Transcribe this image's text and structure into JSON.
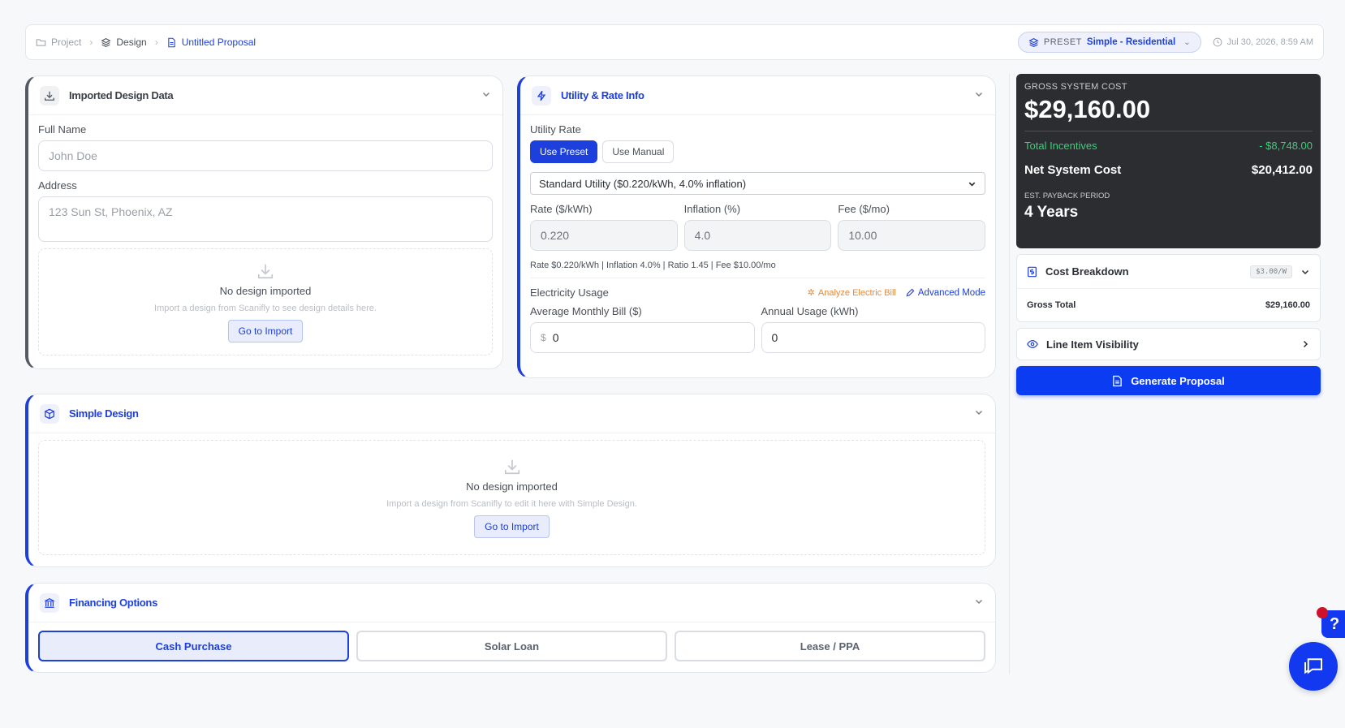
{
  "breadcrumb": {
    "project": "Project",
    "design": "Design",
    "proposal": "Untitled Proposal"
  },
  "preset": {
    "label": "PRESET",
    "value": "Simple - Residential"
  },
  "timestamp": "Jul 30, 2026, 8:59 AM",
  "imported": {
    "title": "Imported Design Data",
    "full_name_label": "Full Name",
    "full_name_placeholder": "John Doe",
    "address_label": "Address",
    "address_placeholder": "123 Sun St, Phoenix, AZ",
    "empty_title": "No design imported",
    "empty_sub": "Import a design from Scanifly to see design details here.",
    "import_btn": "Go to Import"
  },
  "utility": {
    "title": "Utility & Rate Info",
    "rate_label": "Utility Rate",
    "tab_preset": "Use Preset",
    "tab_manual": "Use Manual",
    "select_value": "Standard Utility ($0.220/kWh, 4.0% inflation)",
    "rate_kwh_label": "Rate ($/kWh)",
    "rate_kwh": "0.220",
    "inflation_label": "Inflation (%)",
    "inflation": "4.0",
    "fee_label": "Fee ($/mo)",
    "fee": "10.00",
    "summary": "Rate $0.220/kWh | Inflation 4.0% | Ratio 1.45 | Fee $10.00/mo",
    "usage_label": "Electricity Usage",
    "analyze": "Analyze Electric Bill",
    "advanced": "Advanced Mode",
    "bill_label": "Average Monthly Bill ($)",
    "currency": "$",
    "bill_value": "0",
    "annual_label": "Annual Usage (kWh)",
    "annual_value": "0"
  },
  "simple_design": {
    "title": "Simple Design",
    "empty_title": "No design imported",
    "empty_sub": "Import a design from Scanifly to edit it here with Simple Design.",
    "import_btn": "Go to Import"
  },
  "financing": {
    "title": "Financing Options",
    "options": [
      "Cash Purchase",
      "Solar Loan",
      "Lease / PPA"
    ],
    "selected": "Cash Purchase"
  },
  "summary": {
    "gross_label": "GROSS SYSTEM COST",
    "gross_value": "$29,160.00",
    "incentives_label": "Total Incentives",
    "incentives_value": "- $8,748.00",
    "net_label": "Net System Cost",
    "net_value": "$20,412.00",
    "payback_label": "EST. PAYBACK PERIOD",
    "payback_value": "4 Years"
  },
  "cost_breakdown": {
    "title": "Cost Breakdown",
    "tag": "$3.00/W",
    "gross_total_label": "Gross Total",
    "gross_total_value": "$29,160.00"
  },
  "line_items": {
    "title": "Line Item Visibility"
  },
  "generate": {
    "label": "Generate Proposal"
  },
  "help": {
    "label": "?"
  },
  "colors": {
    "accent": "#1d3fdb",
    "dark": "#2b2d31",
    "green": "#3ccf7a",
    "orange": "#e8893a"
  }
}
